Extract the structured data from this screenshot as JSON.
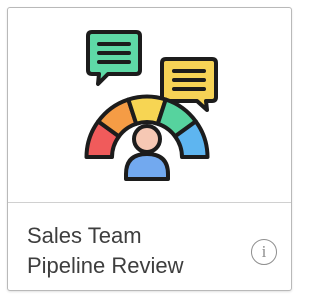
{
  "card": {
    "title_line1": "Sales Team",
    "title_line2": "Pipeline Review",
    "info_glyph": "i",
    "illustration": {
      "icon": "sales-pipeline-review-icon",
      "parts": [
        "green-chat-bubble-icon",
        "yellow-chat-bubble-icon",
        "gauge-icon",
        "person-icon"
      ]
    }
  },
  "colors": {
    "bubble_green": "#5ed9a6",
    "bubble_yellow": "#f6d356",
    "gauge_red": "#f05b5b",
    "gauge_orange": "#f59c45",
    "gauge_yellow": "#f7d553",
    "gauge_green": "#56d39e",
    "gauge_blue": "#5eb5f0",
    "person_head": "#f6c8b4",
    "person_body": "#72a9ef",
    "outline": "#1c1c1c"
  }
}
